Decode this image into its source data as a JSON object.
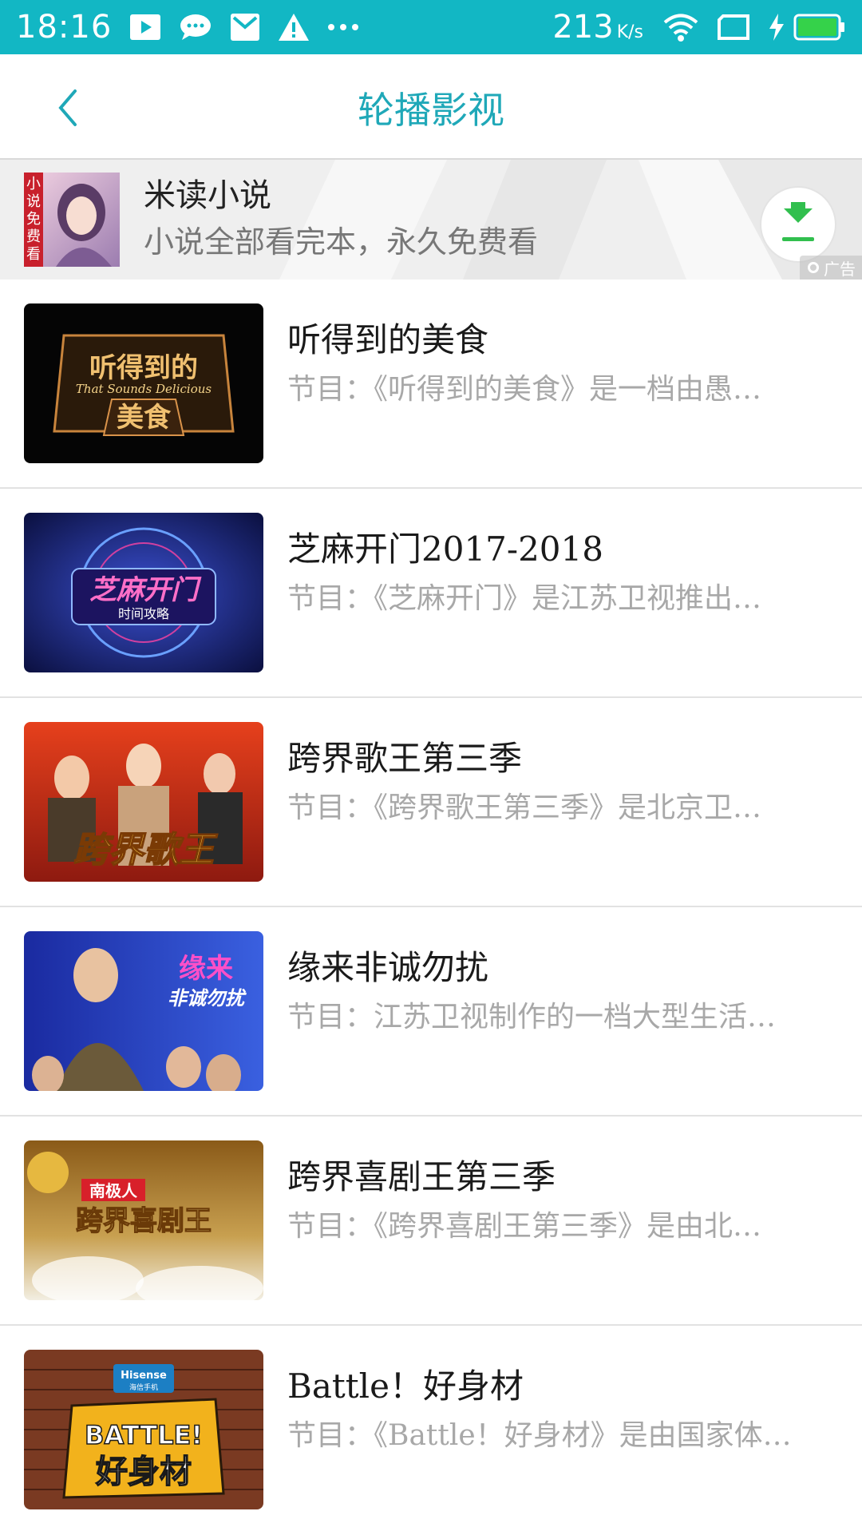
{
  "status_bar": {
    "time": "18:16",
    "speed_value": "213",
    "speed_unit": "K/s",
    "icons": [
      "video-icon",
      "chat-icon",
      "mail-icon",
      "warning-icon",
      "more-icon",
      "wifi-icon",
      "screen-icon",
      "charging-icon",
      "battery-icon"
    ],
    "color": "#12b7c4"
  },
  "header": {
    "title": "轮播影视",
    "accent_color": "#1fa8b8"
  },
  "ad": {
    "thumb_text": [
      "小",
      "说",
      "免",
      "费",
      "看"
    ],
    "title": "米读小说",
    "subtitle": "小说全部看完本，永久免费看",
    "tag": "广告"
  },
  "items": [
    {
      "title": "听得到的美食",
      "desc": "节目：《听得到的美食》是一档由愚…",
      "thumb_text_top": "听得到的",
      "thumb_text_en": "That Sounds Delicious",
      "thumb_text_bottom": "美食"
    },
    {
      "title": "芝麻开门2017-2018",
      "desc": "节目：《芝麻开门》是江苏卫视推出…",
      "thumb_text_top": "芝麻开门",
      "thumb_text_bottom": "时间攻略"
    },
    {
      "title": "跨界歌王第三季",
      "desc": "节目：《跨界歌王第三季》是北京卫…",
      "thumb_text_top": "跨界歌王"
    },
    {
      "title": "缘来非诚勿扰",
      "desc": "节目：江苏卫视制作的一档大型生活…",
      "thumb_text_top": "缘来",
      "thumb_text_bottom": "非诚勿扰"
    },
    {
      "title": "跨界喜剧王第三季",
      "desc": "节目：《跨界喜剧王第三季》是由北…",
      "thumb_text_top": "南极人",
      "thumb_text_bottom": "跨界喜剧王"
    },
    {
      "title": "Battle！好身材",
      "desc": "节目：《Battle！好身材》是由国家体…",
      "thumb_text_brand": "Hisense",
      "thumb_text_brand_sub": "海信手机",
      "thumb_text_top": "BATTLE!",
      "thumb_text_bottom": "好身材"
    }
  ]
}
